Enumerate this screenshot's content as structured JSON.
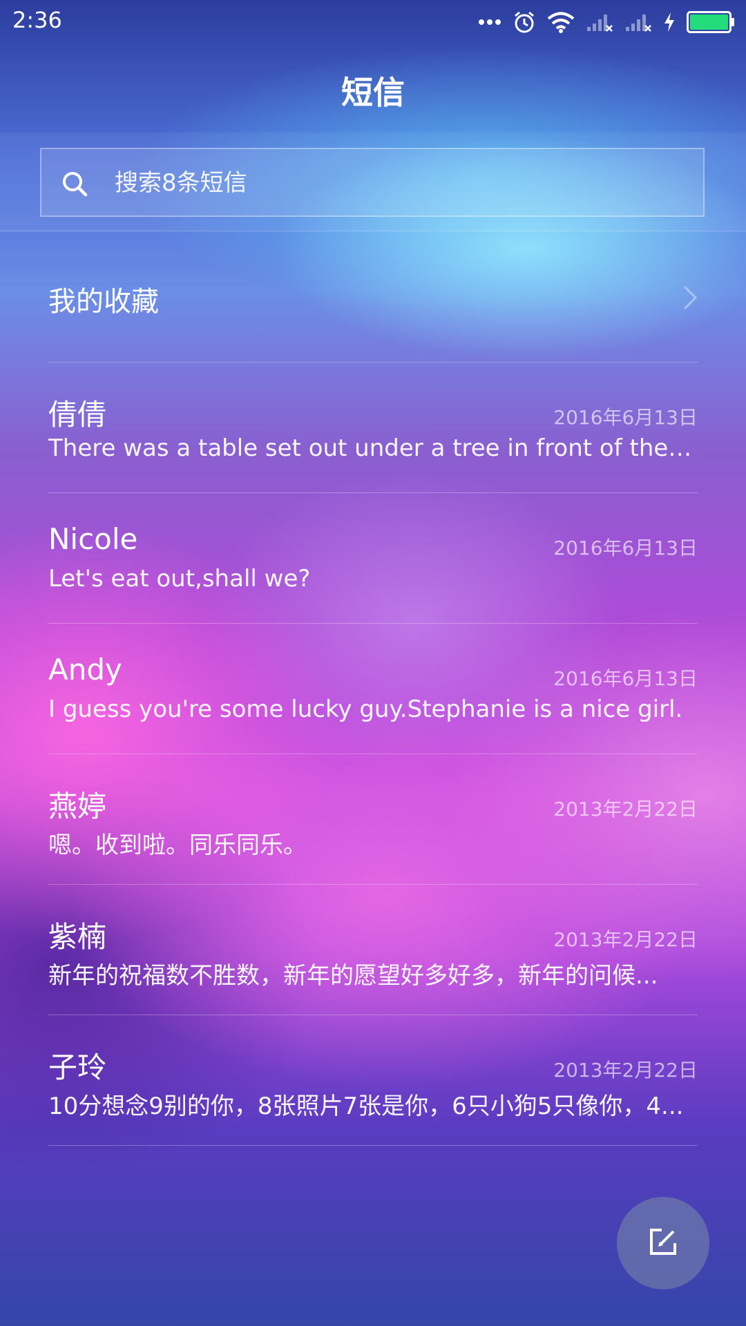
{
  "status_bar": {
    "time": "2:36",
    "icons": [
      "more-dots-icon",
      "alarm-icon",
      "wifi-icon",
      "signal-1-icon",
      "signal-2-icon",
      "charging-icon",
      "battery-icon"
    ],
    "battery_color": "#22dd7a"
  },
  "header": {
    "title": "短信"
  },
  "search": {
    "placeholder": "搜索8条短信",
    "value": ""
  },
  "favorites": {
    "label": "我的收藏"
  },
  "messages": [
    {
      "name": "倩倩",
      "date": "2016年6月13日",
      "preview": "There was a table set out under a tree in front of the ho..."
    },
    {
      "name": "Nicole",
      "date": "2016年6月13日",
      "preview": "Let's eat out,shall we?"
    },
    {
      "name": "Andy",
      "date": "2016年6月13日",
      "preview": "I guess you're some lucky guy.Stephanie is a nice girl."
    },
    {
      "name": "燕婷",
      "date": "2013年2月22日",
      "preview": "嗯。收到啦。同乐同乐。"
    },
    {
      "name": "紫楠",
      "date": "2013年2月22日",
      "preview": "新年的祝福数不胜数，新年的愿望好多好多，新年的问候..."
    },
    {
      "name": "子玲",
      "date": "2013年2月22日",
      "preview": "10分想念9别的你，8张照片7张是你，6只小狗5只像你，4..."
    }
  ],
  "fab": {
    "icon": "compose-icon"
  }
}
